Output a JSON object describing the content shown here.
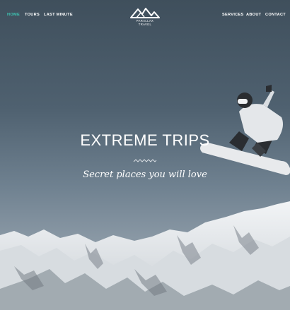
{
  "nav": {
    "left": [
      {
        "label": "HOME",
        "active": true
      },
      {
        "label": "TOURS",
        "active": false
      },
      {
        "label": "LAST MINUTE",
        "active": false
      }
    ],
    "right": [
      {
        "label": "SERVICES"
      },
      {
        "label": "ABOUT"
      },
      {
        "label": "CONTACT"
      }
    ]
  },
  "brand": {
    "name": "PARALLAX TRAVEL",
    "icon": "mountain-logo-icon"
  },
  "hero": {
    "title": "EXTREME TRIPS",
    "subtitle": "Secret places you will love",
    "divider_icon": "wave-divider-icon"
  },
  "colors": {
    "accent": "#3ec6b4",
    "text": "#ffffff",
    "sky_top": "#3f4f5c",
    "sky_bottom": "#a9b3bc"
  }
}
